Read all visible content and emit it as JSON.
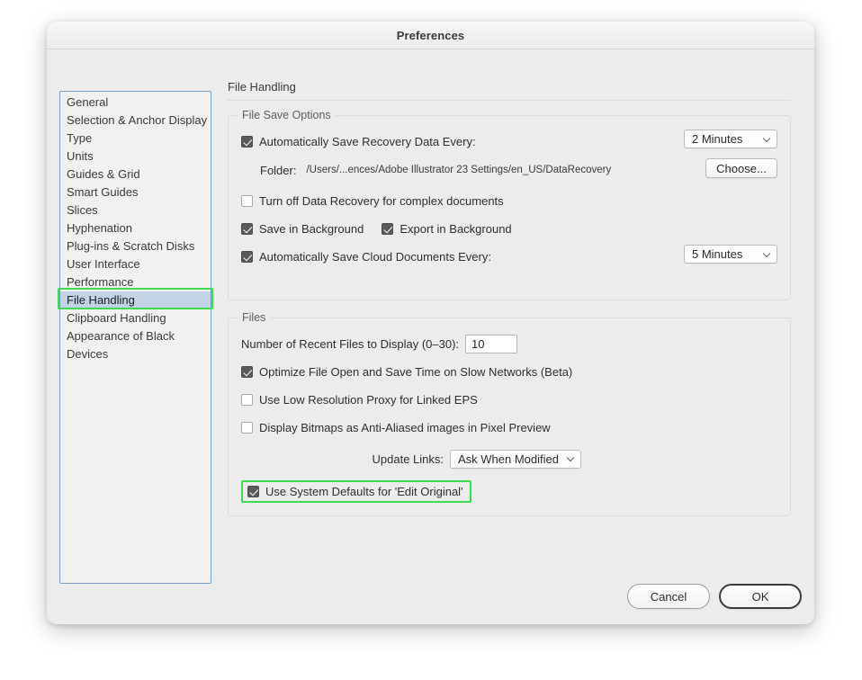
{
  "window": {
    "title": "Preferences"
  },
  "sidebar": {
    "items": [
      {
        "label": "General",
        "selected": false
      },
      {
        "label": "Selection & Anchor Display",
        "selected": false
      },
      {
        "label": "Type",
        "selected": false
      },
      {
        "label": "Units",
        "selected": false
      },
      {
        "label": "Guides & Grid",
        "selected": false
      },
      {
        "label": "Smart Guides",
        "selected": false
      },
      {
        "label": "Slices",
        "selected": false
      },
      {
        "label": "Hyphenation",
        "selected": false
      },
      {
        "label": "Plug-ins & Scratch Disks",
        "selected": false
      },
      {
        "label": "User Interface",
        "selected": false
      },
      {
        "label": "Performance",
        "selected": false
      },
      {
        "label": "File Handling",
        "selected": true
      },
      {
        "label": "Clipboard Handling",
        "selected": false
      },
      {
        "label": "Appearance of Black",
        "selected": false
      },
      {
        "label": "Devices",
        "selected": false
      }
    ]
  },
  "pane": {
    "title": "File Handling",
    "file_save_options": {
      "legend": "File Save Options",
      "auto_save_recovery": {
        "label": "Automatically Save Recovery Data Every:",
        "checked": true,
        "interval": "2 Minutes"
      },
      "folder": {
        "label": "Folder:",
        "path": "/Users/...ences/Adobe Illustrator 23 Settings/en_US/DataRecovery",
        "choose_label": "Choose..."
      },
      "turn_off_recovery": {
        "label": "Turn off Data Recovery for complex documents",
        "checked": false
      },
      "save_in_background": {
        "label": "Save in Background",
        "checked": true
      },
      "export_in_background": {
        "label": "Export in Background",
        "checked": true
      },
      "auto_save_cloud": {
        "label": "Automatically Save Cloud Documents Every:",
        "checked": true,
        "interval": "5 Minutes"
      }
    },
    "files": {
      "legend": "Files",
      "recent_files": {
        "label": "Number of Recent Files to Display (0–30):",
        "value": "10"
      },
      "optimize_file_open": {
        "label": "Optimize File Open and Save Time on Slow Networks (Beta)",
        "checked": true
      },
      "low_res_proxy": {
        "label": "Use Low Resolution Proxy for Linked EPS",
        "checked": false
      },
      "display_bitmaps": {
        "label": "Display Bitmaps as Anti-Aliased images in Pixel Preview",
        "checked": false
      },
      "update_links": {
        "label": "Update Links:",
        "value": "Ask When Modified"
      },
      "edit_original": {
        "label": "Use System Defaults for 'Edit Original'",
        "checked": true
      }
    }
  },
  "footer": {
    "cancel_label": "Cancel",
    "ok_label": "OK"
  },
  "colors": {
    "highlight_ring": "#3ddc4e",
    "selection_bg": "#c2d3e8",
    "dialog_bg": "#ececec"
  }
}
